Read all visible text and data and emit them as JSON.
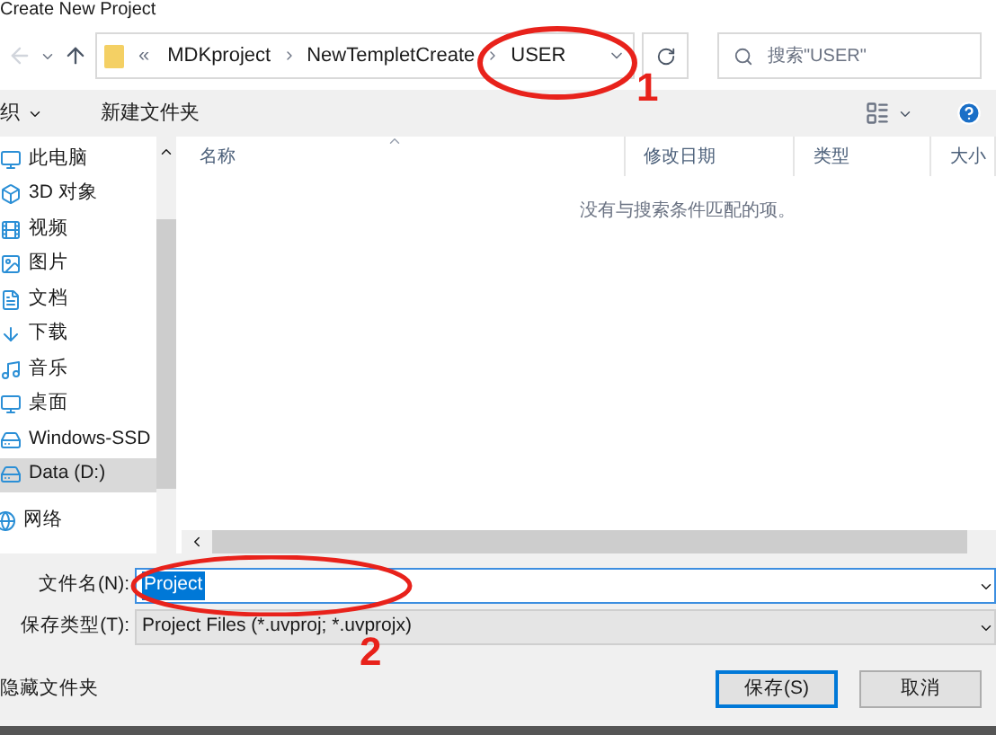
{
  "window": {
    "title": "Create New Project"
  },
  "address_bar": {
    "path": [
      {
        "label": "MDKproject"
      },
      {
        "label": "NewTempletCreate"
      },
      {
        "label": "USER"
      }
    ],
    "overflow": "«"
  },
  "search": {
    "placeholder": "搜索\"USER\""
  },
  "toolbar": {
    "organize": "织",
    "new_folder": "新建文件夹"
  },
  "sidebar": {
    "items": [
      {
        "label": "此电脑",
        "selected": false
      },
      {
        "label": "3D 对象",
        "selected": false
      },
      {
        "label": "视频",
        "selected": false
      },
      {
        "label": "图片",
        "selected": false
      },
      {
        "label": "文档",
        "selected": false
      },
      {
        "label": "下载",
        "selected": false
      },
      {
        "label": "音乐",
        "selected": false
      },
      {
        "label": "桌面",
        "selected": false
      },
      {
        "label": "Windows-SSD",
        "selected": false
      },
      {
        "label": "Data (D:)",
        "selected": true
      },
      {
        "label": "网络",
        "selected": false
      }
    ]
  },
  "table": {
    "columns": [
      "名称",
      "修改日期",
      "类型",
      "大小"
    ],
    "empty_message": "没有与搜索条件匹配的项。"
  },
  "form": {
    "filename_label": "文件名(N):",
    "filename_value": "Project",
    "filetype_label": "保存类型(T):",
    "filetype_value": "Project Files (*.uvproj; *.uvprojx)"
  },
  "hide_folders": "隐藏文件夹",
  "buttons": [
    {
      "label": "保存(S)",
      "default": true
    },
    {
      "label": "取消",
      "default": false
    }
  ],
  "annotations": [
    {
      "label": "1"
    },
    {
      "label": "2"
    }
  ]
}
